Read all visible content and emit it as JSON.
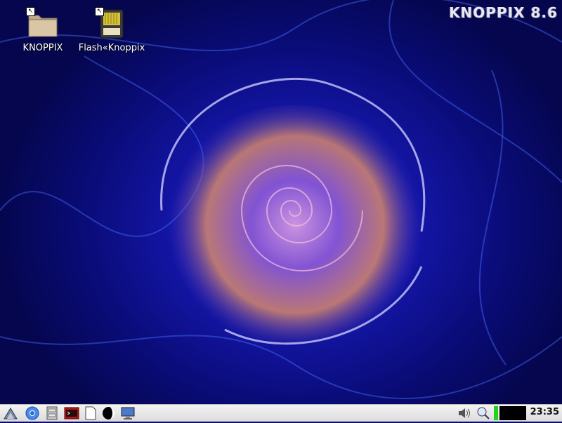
{
  "desktop": {
    "brand": "KNOPPIX 8.6",
    "icons": [
      {
        "label": "KNOPPIX",
        "icon": "folder-icon"
      },
      {
        "label": "Flash«Knoppix",
        "icon": "sd-card-icon"
      }
    ]
  },
  "taskbar": {
    "launchers": [
      "start-menu-icon",
      "chromium-icon",
      "file-cabinet-icon",
      "terminal-icon",
      "text-document-icon",
      "shutdown-icon",
      "monitor-icon"
    ],
    "tray": [
      "volume-icon",
      "network-search-icon",
      "cpu-meter",
      "workspace-pager"
    ],
    "clock": "23:35"
  },
  "colors": {
    "desktop_base": "#0a0c7a",
    "swirl_accent": "#e29a6a",
    "taskbar_bg": "#e6e6e6",
    "cpu_meter": "#1fd31f"
  }
}
